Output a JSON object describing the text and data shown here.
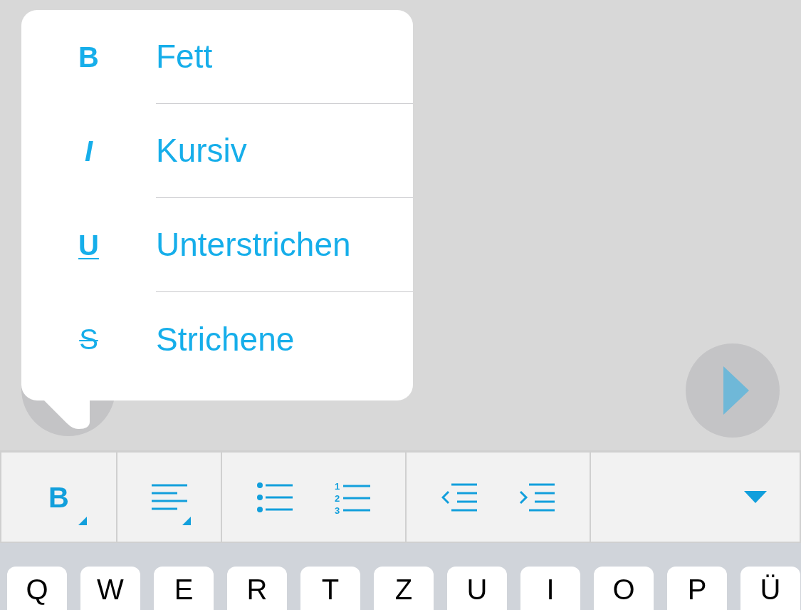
{
  "format_menu": [
    {
      "kind": "bold",
      "icon": "B",
      "label": "Fett"
    },
    {
      "kind": "italic",
      "icon": "I",
      "label": "Kursiv"
    },
    {
      "kind": "underline",
      "icon": "U",
      "label": "Unterstrichen"
    },
    {
      "kind": "strike",
      "icon": "S",
      "label": "Strichene"
    }
  ],
  "toolbar": {
    "bold_button": "B",
    "numbered_list_digits": [
      "1",
      "2",
      "3"
    ]
  },
  "keyboard": {
    "keys": [
      "Q",
      "W",
      "E",
      "R",
      "T",
      "Z",
      "U",
      "I",
      "O",
      "P",
      "Ü"
    ]
  }
}
